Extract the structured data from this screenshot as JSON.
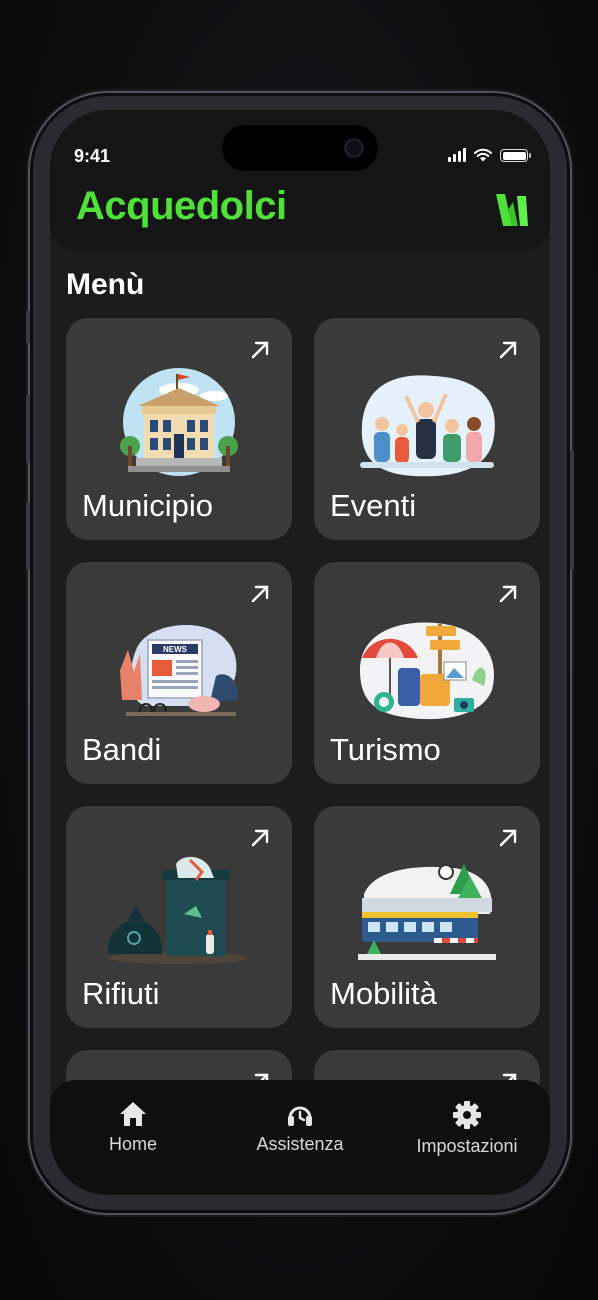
{
  "status_bar": {
    "time": "9:41"
  },
  "header": {
    "app_name": "Acquedolci",
    "logo_icon": "app-logo-icon"
  },
  "main": {
    "section_title": "Menù",
    "cards": [
      {
        "label": "Municipio",
        "icon": "town-hall-illustration"
      },
      {
        "label": "Eventi",
        "icon": "people-celebrating-illustration"
      },
      {
        "label": "Bandi",
        "icon": "newspaper-illustration"
      },
      {
        "label": "Turismo",
        "icon": "travel-luggage-illustration"
      },
      {
        "label": "Rifiuti",
        "icon": "waste-bin-illustration"
      },
      {
        "label": "Mobilità",
        "icon": "train-illustration"
      }
    ]
  },
  "tabbar": {
    "items": [
      {
        "label": "Home",
        "icon": "home-icon"
      },
      {
        "label": "Assistenza",
        "icon": "headset-icon"
      },
      {
        "label": "Impostazioni",
        "icon": "gear-icon"
      }
    ]
  },
  "colors": {
    "brand_green": "#4fe03a",
    "card_bg": "#3a3a3b",
    "screen_bg": "#1c1c1d"
  }
}
